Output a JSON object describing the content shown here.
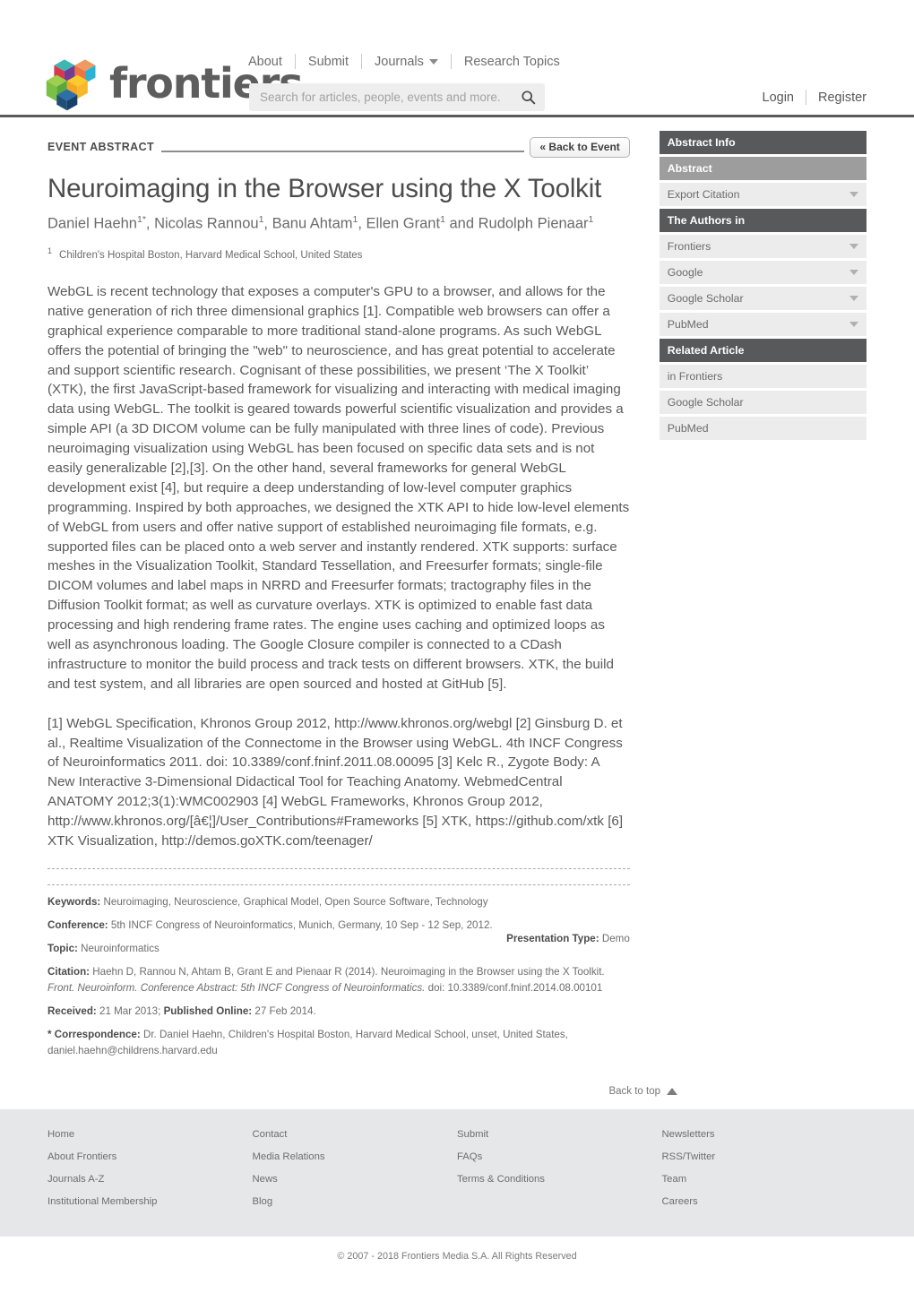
{
  "header": {
    "logo_text": "frontiers",
    "nav": [
      {
        "label": "About",
        "has_caret": false
      },
      {
        "label": "Submit",
        "has_caret": false
      },
      {
        "label": "Journals",
        "has_caret": true
      },
      {
        "label": "Research Topics",
        "has_caret": false
      }
    ],
    "search": {
      "placeholder": "Search for articles, people, events and more.",
      "value": "",
      "icon": "search-icon"
    },
    "account": [
      {
        "label": "Login"
      },
      {
        "label": "Register"
      }
    ]
  },
  "article": {
    "eyebrow": "EVENT ABSTRACT",
    "back_to_event": "« Back to Event",
    "title": "Neuroimaging in the Browser using the X Toolkit",
    "authors_html": "Daniel Haehn<sup>1*</sup>, Nicolas Rannou<sup>1</sup>, Banu Ahtam<sup>1</sup>, Ellen Grant<sup>1</sup> and Rudolph Pienaar<sup>1</sup>",
    "affiliation_marker": "1",
    "affiliation": "Children's Hospital Boston, Harvard Medical School, United States",
    "abstract": "WebGL is recent technology that exposes a computer's GPU to a browser, and allows for the native generation of rich three dimensional graphics [1]. Compatible web browsers can offer a graphical experience comparable to more traditional stand-alone programs. As such WebGL offers the potential of bringing the \"web\" to neuroscience, and has great potential to accelerate and support scientific research. Cognisant of these possibilities, we present ‘The X Toolkit’ (XTK), the first JavaScript-based framework for visualizing and interacting with medical imaging data using WebGL. The toolkit is geared towards powerful scientific visualization and provides a simple API (a 3D DICOM volume can be fully manipulated with three lines of code). Previous neuroimaging visualization using WebGL has been focused on specific data sets and is not easily generalizable [2],[3]. On the other hand, several frameworks for general WebGL development exist [4], but require a deep understanding of low-level computer graphics programming. Inspired by both approaches, we designed the XTK API to hide low-level elements of WebGL from users and offer native support of established neuroimaging file formats, e.g. supported files can be placed onto a web server and instantly rendered. XTK supports: surface meshes in the Visualization Toolkit, Standard Tessellation, and Freesurfer formats; single-file DICOM volumes and label maps in NRRD and Freesurfer formats; tractography files in the Diffusion Toolkit format; as well as curvature overlays. XTK is optimized to enable fast data processing and high rendering frame rates. The engine uses caching and optimized loops as well as asynchronous loading. The Google Closure compiler is connected to a CDash infrastructure to monitor the build process and track tests on different browsers. XTK, the build and test system, and all libraries are open sourced and hosted at GitHub [5].",
    "references": "[1] WebGL Specification, Khronos Group 2012, http://www.khronos.org/webgl [2] Ginsburg D. et al., Realtime Visualization of the Connectome in the Browser using WebGL. 4th INCF Congress of Neuroinformatics 2011. doi: 10.3389/conf.fninf.2011.08.00095 [3] Kelc R., Zygote Body: A New Interactive 3-Dimensional Didactical Tool for Teaching Anatomy. WebmedCentral ANATOMY 2012;3(1):WMC002903 [4] WebGL Frameworks, Khronos Group 2012, http://www.khronos.org/[â€¦]/User_Contributions#Frameworks [5] XTK, https://github.com/xtk [6] XTK Visualization, http://demos.goXTK.com/teenager/"
  },
  "meta": {
    "keywords_label": "Keywords:",
    "keywords_value": "Neuroimaging, Neuroscience, Graphical Model, Open Source Software, Technology",
    "conference_label": "Conference:",
    "conference_value": "5th INCF Congress of Neuroinformatics, Munich, Germany, 10 Sep - 12 Sep, 2012.",
    "presentation_type_label": "Presentation Type:",
    "presentation_type_value": "Demo",
    "topic_label": "Topic:",
    "topic_value": "Neuroinformatics",
    "citation_label": "Citation:",
    "citation_plain": "Haehn D, Rannou N, Ahtam B, Grant E and Pienaar R (2014). Neuroimaging in the Browser using the X Toolkit.",
    "citation_italic": "Front. Neuroinform. Conference Abstract: 5th INCF Congress of Neuroinformatics.",
    "citation_doi": "doi: 10.3389/conf.fninf.2014.08.00101",
    "received_label": "Received:",
    "received_value": "21 Mar 2013;",
    "published_label": "Published Online:",
    "published_value": "27 Feb 2014.",
    "correspondence_label": "* Correspondence:",
    "correspondence_value": "Dr. Daniel Haehn, Children's Hospital Boston, Harvard Medical School, unset, United States, daniel.haehn@childrens.harvard.edu"
  },
  "sidebar": {
    "items": [
      {
        "label": "Abstract Info",
        "style": "head",
        "caret": false
      },
      {
        "label": "Abstract",
        "style": "subhead",
        "caret": false
      },
      {
        "label": "Export Citation",
        "style": "link",
        "caret": true
      },
      {
        "label": "The Authors in",
        "style": "head",
        "caret": false
      },
      {
        "label": "Frontiers",
        "style": "link",
        "caret": true
      },
      {
        "label": "Google",
        "style": "link",
        "caret": true
      },
      {
        "label": "Google Scholar",
        "style": "link",
        "caret": true
      },
      {
        "label": "PubMed",
        "style": "link",
        "caret": true
      },
      {
        "label": "Related Article",
        "style": "head",
        "caret": false
      },
      {
        "label": "in Frontiers",
        "style": "link",
        "caret": false
      },
      {
        "label": "Google Scholar",
        "style": "link",
        "caret": false
      },
      {
        "label": "PubMed",
        "style": "link",
        "caret": false
      }
    ]
  },
  "back_to_top": "Back to top",
  "footer": {
    "columns": [
      {
        "links": [
          "Home",
          "About Frontiers",
          "Journals A-Z",
          "Institutional Membership"
        ]
      },
      {
        "links": [
          "Contact",
          "Media Relations",
          "News",
          "Blog"
        ]
      },
      {
        "links": [
          "Submit",
          "FAQs",
          "Terms & Conditions"
        ]
      },
      {
        "links": [
          "Newsletters",
          "RSS/Twitter",
          "Team",
          "Careers"
        ]
      }
    ],
    "copyright": "© 2007 - 2018 Frontiers Media S.A. All Rights Reserved"
  },
  "colors": {
    "sidebar_head": "#58595b",
    "sidebar_subhead": "#9d9d9d",
    "sidebar_link": "#ececec",
    "footer_bg": "#e6e7e8"
  }
}
